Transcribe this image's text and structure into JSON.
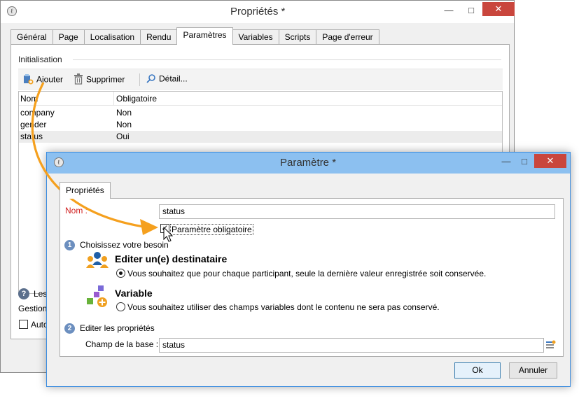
{
  "back_window": {
    "title": "Propriétés *",
    "controls": {
      "minimize": "—",
      "maximize": "□",
      "close": "✕"
    },
    "tabs": [
      "Général",
      "Page",
      "Localisation",
      "Rendu",
      "Paramètres",
      "Variables",
      "Scripts",
      "Page d'erreur"
    ],
    "active_tab": "Paramètres",
    "group_label": "Initialisation",
    "toolbar": {
      "add": "Ajouter",
      "delete": "Supprimer",
      "detail": "Détail..."
    },
    "list": {
      "columns": [
        "Nom",
        "Obligatoire"
      ],
      "rows": [
        {
          "name": "company",
          "required": "Non"
        },
        {
          "name": "gender",
          "required": "Non"
        },
        {
          "name": "status",
          "required": "Oui"
        }
      ]
    },
    "bottom": {
      "info_label": "Les",
      "gestion_label": "Gestion",
      "auto_label": "Auto"
    }
  },
  "dialog": {
    "title": "Paramètre *",
    "controls": {
      "minimize": "—",
      "maximize": "□",
      "close": "✕"
    },
    "tab": "Propriétés",
    "name_label": "Nom :",
    "name_value": "status",
    "mandatory_label": "Paramètre obligatoire",
    "mandatory_checked": true,
    "step1": {
      "number": "1",
      "label": "Choisissez votre besoin"
    },
    "option_recipient": {
      "title": "Editer un(e) destinataire",
      "description": "Vous souhaitez que pour chaque participant, seule la dernière valeur enregistrée soit conservée.",
      "selected": true
    },
    "option_variable": {
      "title": "Variable",
      "description": "Vous souhaitez utiliser des champs variables dont le contenu ne sera pas conservé.",
      "selected": false
    },
    "step2": {
      "number": "2",
      "label": "Editer les propriétés"
    },
    "db_field_label": "Champ de la base :",
    "db_field_value": "status",
    "ok_label": "Ok",
    "cancel_label": "Annuler"
  },
  "colors": {
    "accent_arrow": "#f5a01e",
    "dialog_titlebar": "#8cc0f0",
    "close_button": "#c9463d",
    "required_label": "#d02020"
  }
}
